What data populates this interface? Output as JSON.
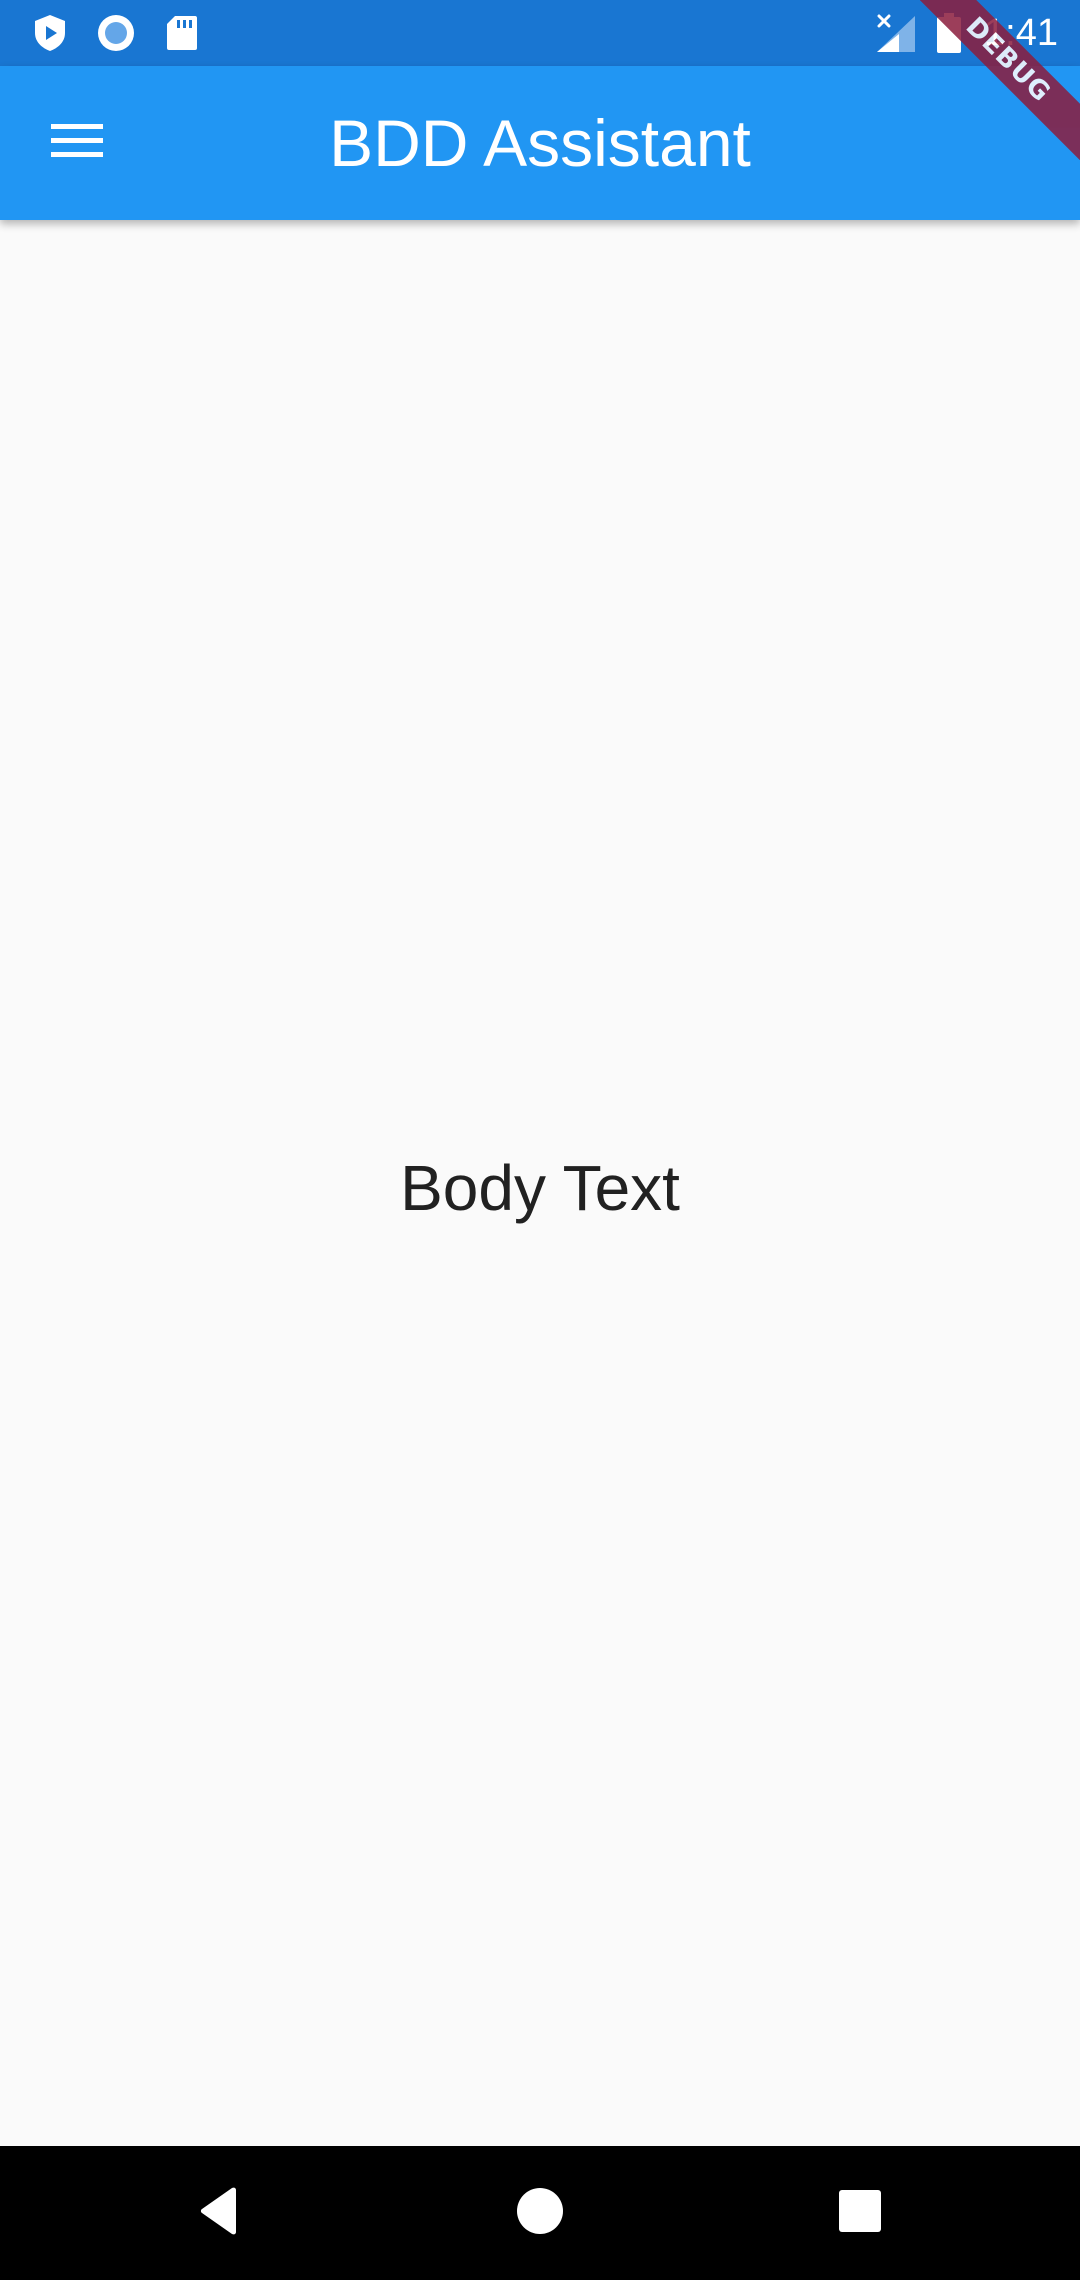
{
  "status_bar": {
    "time": "1:41",
    "left_icons": [
      "shield-play-icon",
      "record-icon",
      "sd-card-icon"
    ],
    "right_icons": [
      "signal-no-data-icon",
      "battery-icon"
    ],
    "color": "#1976d2"
  },
  "app_bar": {
    "title": "BDD Assistant",
    "menu_icon": "hamburger-menu-icon",
    "color": "#2196f3"
  },
  "debug_banner": {
    "label": "DEBUG"
  },
  "body": {
    "text": "Body Text"
  },
  "nav_bar": {
    "buttons": [
      "back-icon",
      "home-icon",
      "recents-icon"
    ]
  }
}
